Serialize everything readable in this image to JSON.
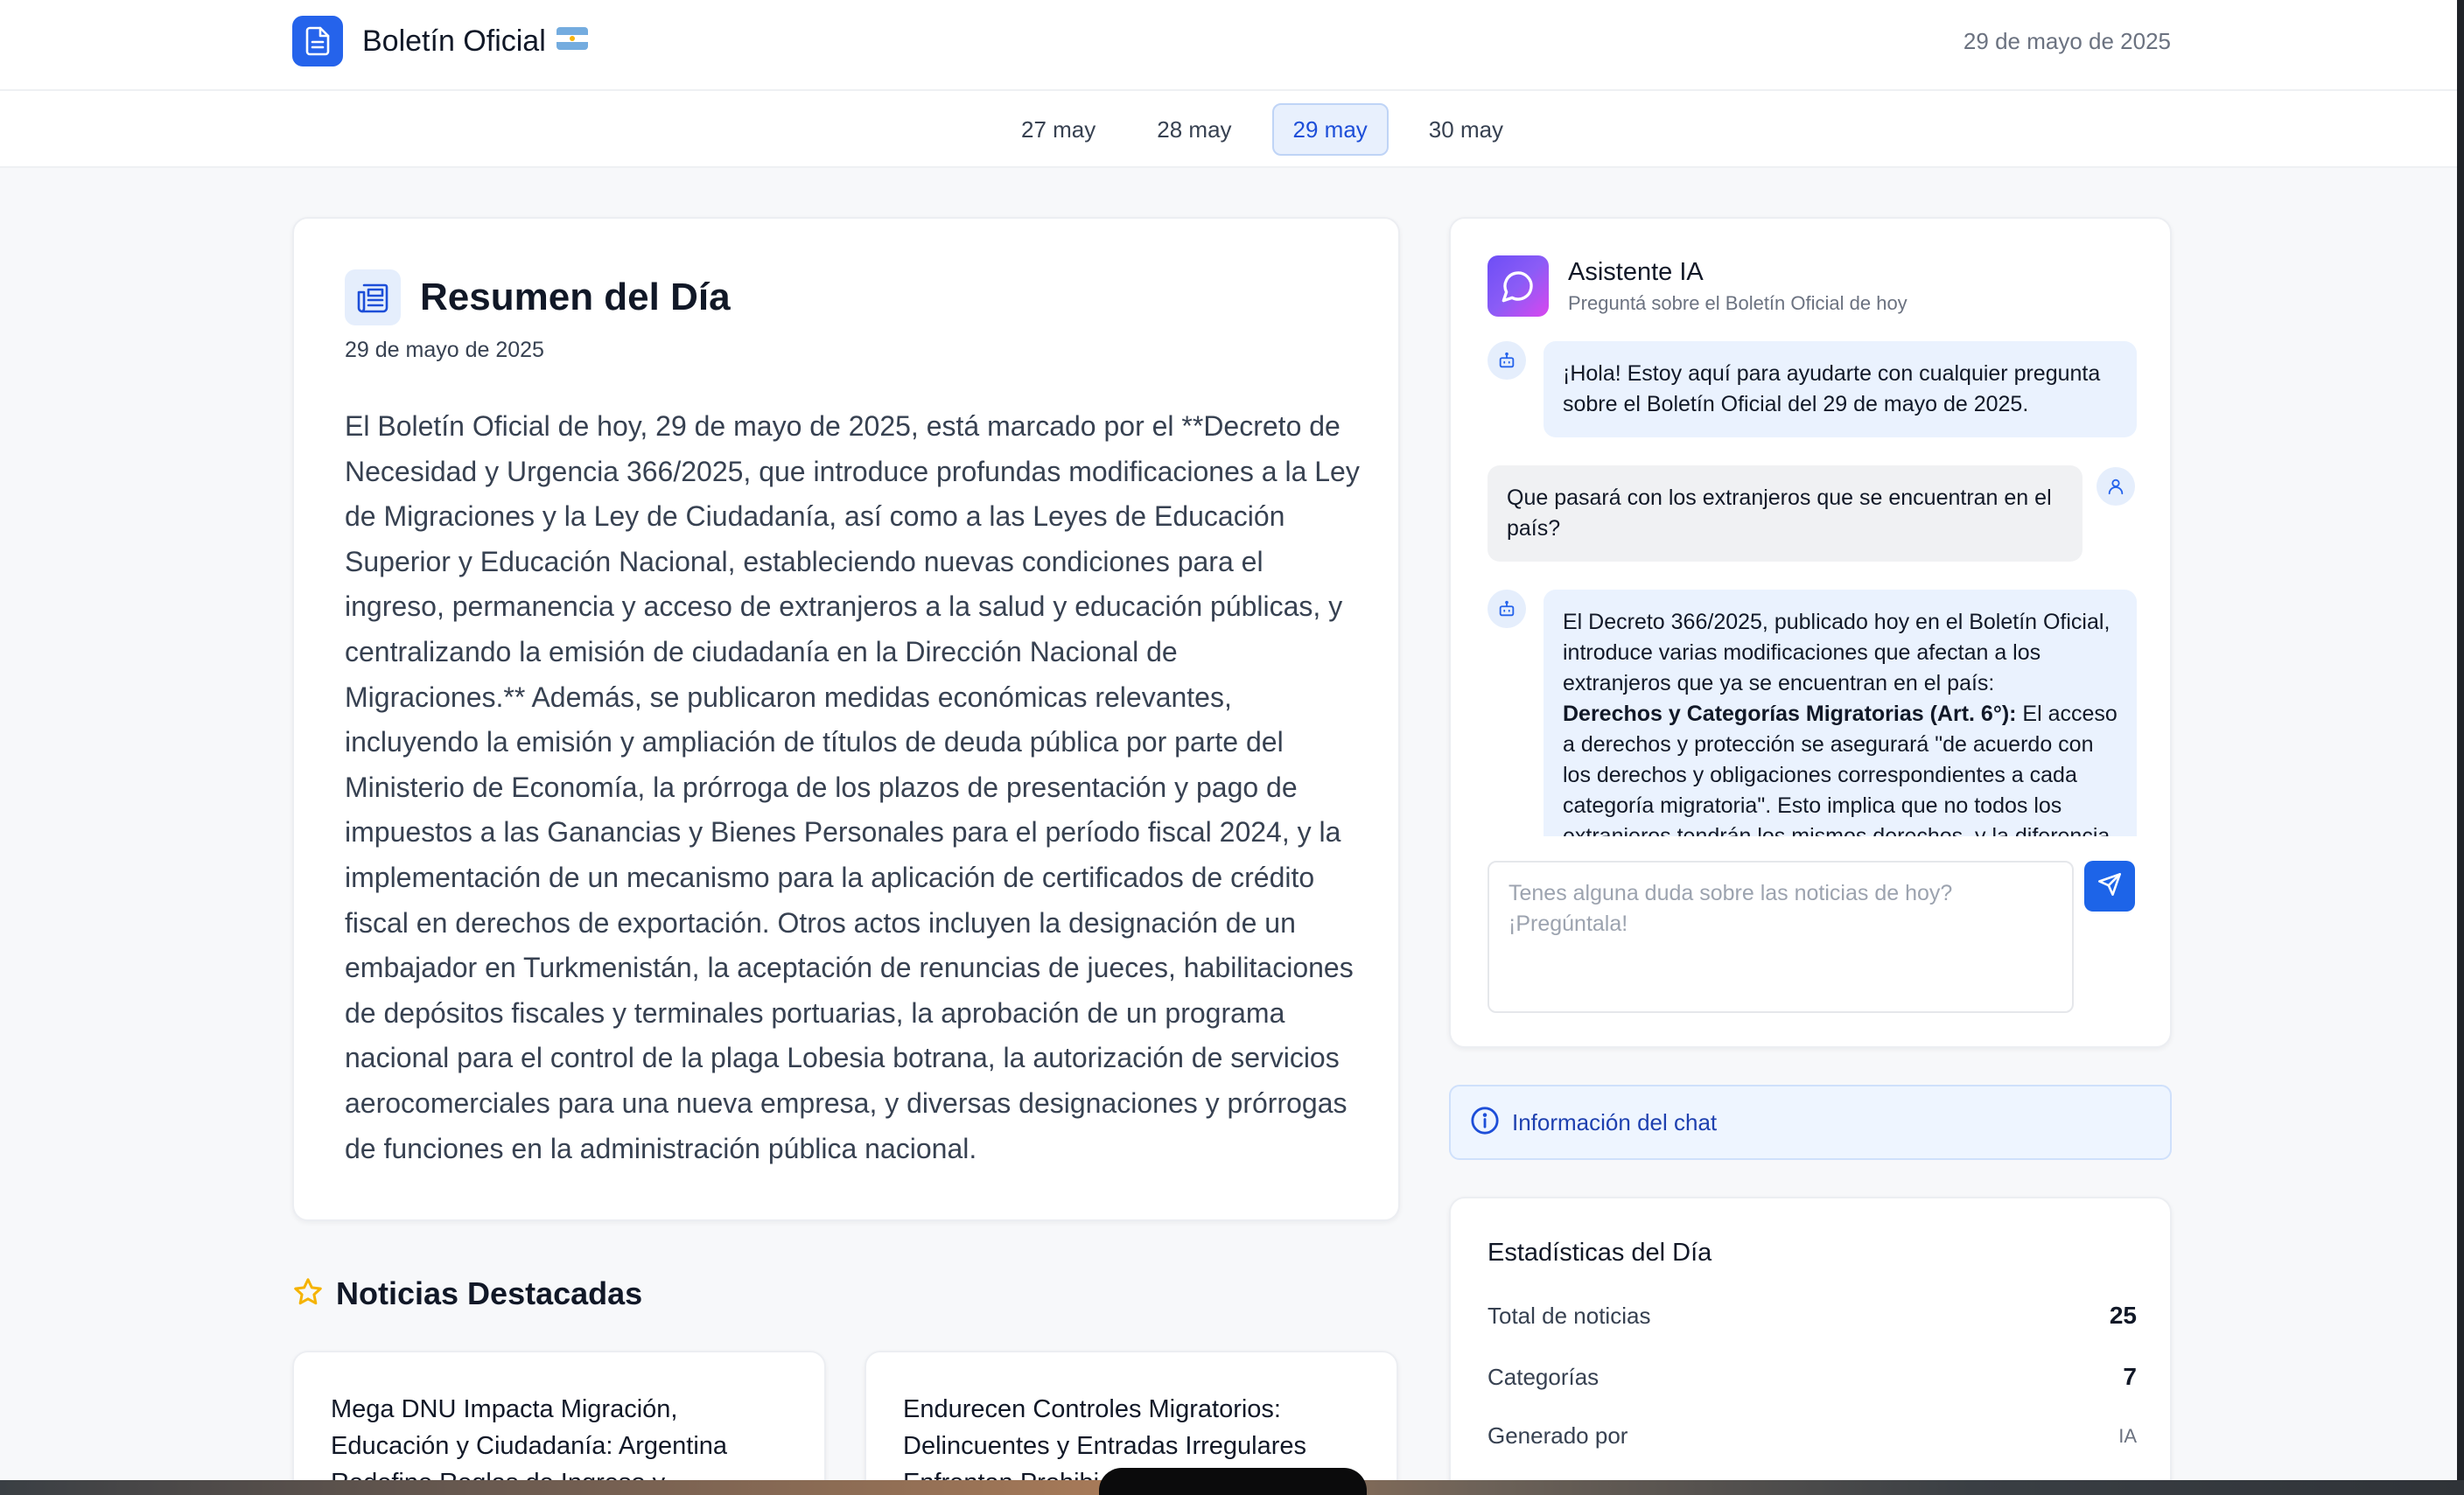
{
  "header": {
    "title": "Boletín Oficial",
    "date": "29 de mayo de 2025"
  },
  "date_tabs": [
    {
      "label": "27 may",
      "active": false
    },
    {
      "label": "28 may",
      "active": false
    },
    {
      "label": "29 may",
      "active": true
    },
    {
      "label": "30 may",
      "active": false
    }
  ],
  "summary": {
    "title": "Resumen del Día",
    "date": "29 de mayo de 2025",
    "text": "El Boletín Oficial de hoy, 29 de mayo de 2025, está marcado por el **Decreto de Necesidad y Urgencia 366/2025, que introduce profundas modificaciones a la Ley de Migraciones y la Ley de Ciudadanía, así como a las Leyes de Educación Superior y Educación Nacional, estableciendo nuevas condiciones para el ingreso, permanencia y acceso de extranjeros a la salud y educación públicas, y centralizando la emisión de ciudadanía en la Dirección Nacional de Migraciones.** Además, se publicaron medidas económicas relevantes, incluyendo la emisión y ampliación de títulos de deuda pública por parte del Ministerio de Economía, la prórroga de los plazos de presentación y pago de impuestos a las Ganancias y Bienes Personales para el período fiscal 2024, y la implementación de un mecanismo para la aplicación de certificados de crédito fiscal en derechos de exportación. Otros actos incluyen la designación de un embajador en Turkmenistán, la aceptación de renuncias de jueces, habilitaciones de depósitos fiscales y terminales portuarias, la aprobación de un programa nacional para el control de la plaga Lobesia botrana, la autorización de servicios aerocomerciales para una nueva empresa, y diversas designaciones y prórrogas de funciones en la administración pública nacional."
  },
  "assistant": {
    "title": "Asistente IA",
    "subtitle": "Preguntá sobre el Boletín Oficial de hoy",
    "messages": [
      {
        "role": "bot",
        "text": "¡Hola! Estoy aquí para ayudarte con cualquier pregunta sobre el Boletín Oficial del 29 de mayo de 2025."
      },
      {
        "role": "user",
        "text": "Que pasará con los extranjeros que se encuentran en el país?"
      },
      {
        "role": "bot",
        "intro": "El Decreto 366/2025, publicado hoy en el Boletín Oficial, introduce varias modificaciones que afectan a los extranjeros que ya se encuentran en el país:",
        "bold": "Derechos y Categorías Migratorias (Art. 6°):",
        "rest": " El acceso a derechos y protección se asegurará \"de acuerdo con los derechos y obligaciones correspondientes a cada categoría migratoria\". Esto implica que no todos los extranjeros tendrán los mismos derechos, y la diferencia dependerá de su categoría migratoria."
      }
    ],
    "input_placeholder": "Tenes alguna duda sobre las noticias de hoy? ¡Pregúntala!"
  },
  "chat_info": {
    "label": "Información del chat"
  },
  "stats": {
    "title": "Estadísticas del Día",
    "rows": [
      {
        "label": "Total de noticias",
        "value": "25"
      },
      {
        "label": "Categorías",
        "value": "7"
      },
      {
        "label": "Generado por",
        "value": "IA"
      }
    ]
  },
  "featured": {
    "title": "Noticias Destacadas",
    "items": [
      {
        "title": "Mega DNU Impacta Migración, Educación y Ciudadanía: Argentina Redefine Reglas de Ingreso y"
      },
      {
        "title": "Endurecen Controles Migratorios: Delincuentes y Entradas Irregulares Enfrentan Prohibi"
      }
    ]
  },
  "colors": {
    "accent": "#2563eb",
    "active_tab_bg": "#e8f0fd",
    "bot_bubble": "#eaf2fe",
    "user_bubble": "#f0f1f3",
    "star": "#f5b301"
  },
  "icons": {
    "brand": "document-icon",
    "summary": "newspaper-icon",
    "assistant": "chat-bubble-icon",
    "bot_avatar": "robot-icon",
    "user_avatar": "user-icon",
    "send": "send-icon",
    "info": "info-icon",
    "featured": "star-icon"
  }
}
